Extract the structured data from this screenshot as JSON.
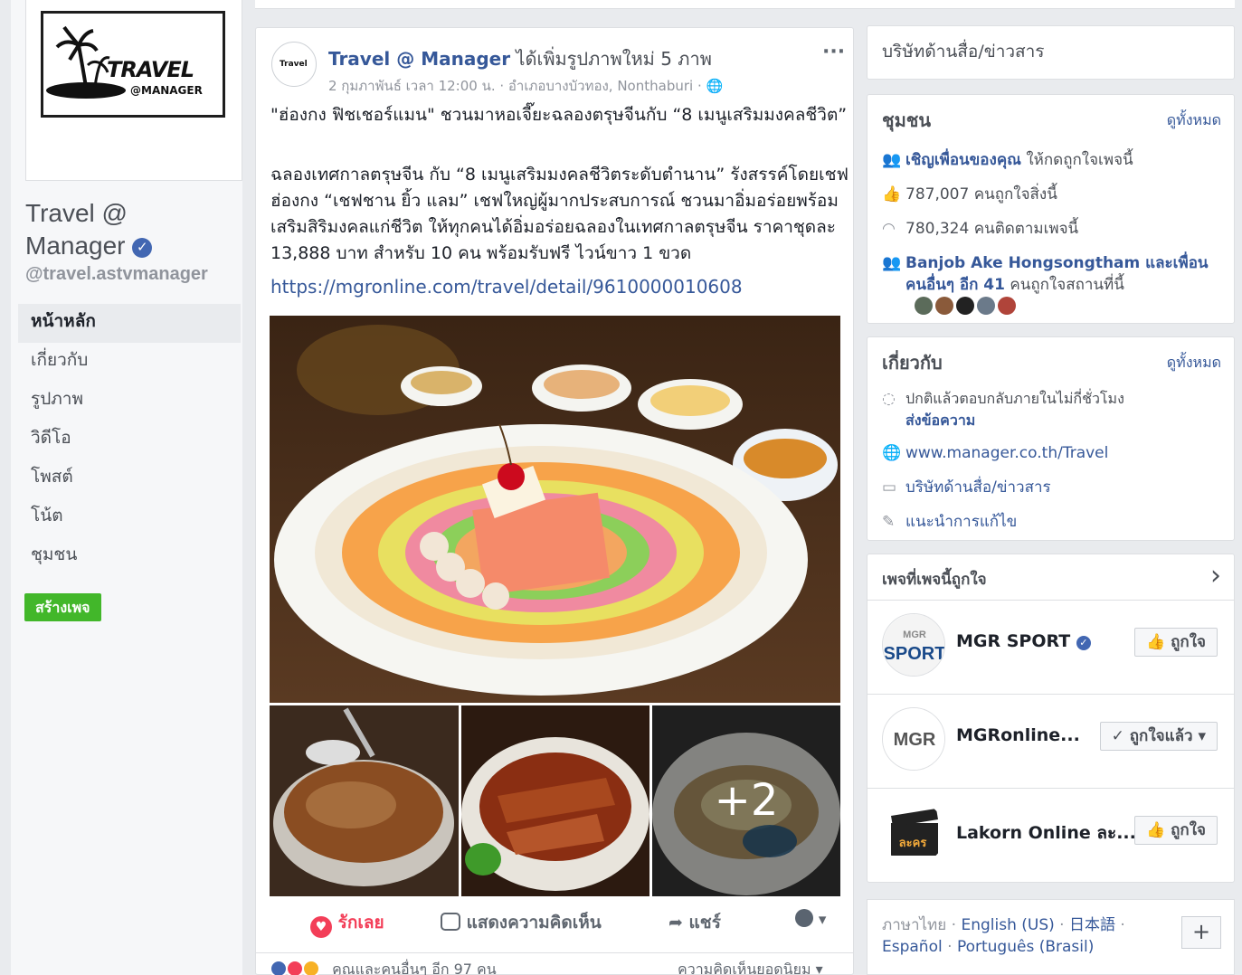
{
  "page": {
    "logo_line1": "TRAVEL",
    "logo_line2": "@MANAGER",
    "name_line1": "Travel @",
    "name_line2": "Manager",
    "verified_mark": "✓",
    "handle": "@travel.astvmanager",
    "create_page": "สร้างเพจ"
  },
  "nav": {
    "items": [
      "หน้าหลัก",
      "เกี่ยวกับ",
      "รูปภาพ",
      "วิดีโอ",
      "โพสต์",
      "โน้ต",
      "ชุมชน"
    ]
  },
  "post": {
    "avatar_text": "Travel",
    "author": "Travel @ Manager",
    "action": " ได้เพิ่มรูปภาพใหม่ 5 ภาพ",
    "meta": "2 กุมภาพันธ์ เวลา 12:00 น. · อำเภอบางบัวทอง, Nonthaburi · 🌐",
    "more": "···",
    "text_title": "\"ฮ่องกง ฟิชเชอร์แมน\" ชวนมาหอเจี๊ยะฉลองตรุษจีนกับ “8 เมนูเสริมมงคลชีวิต”",
    "text_body": "ฉลองเทศกาลตรุษจีน กับ “8 เมนูเสริมมงคลชีวิตระดับตำนาน” รังสรรค์โดยเชฟฮ่องกง “เชฟชาน ยิ้ว แลม” เชฟใหญ่ผู้มากประสบการณ์ ชวนมาอิ่มอร่อยพร้อมเสริมสิริมงคลแก่ชีวิต ให้ทุกคนได้อิ่มอร่อยฉลองในเทศกาลตรุษจีน ราคาชุดละ 13,888 บาท สำหรับ 10 คน พร้อมรับฟรี ไวน์ขาว 1 ขวด",
    "link": "https://mgronline.com/travel/detail/9610000010608",
    "more_photos": "+2",
    "love": "รักเลย",
    "comment": "แสดงความคิดเห็น",
    "share": "แชร์",
    "reactions_text": "คุณและคนอื่นๆ อีก 97 คน",
    "top_comments": "ความคิดเห็นยอดนิยม ▾"
  },
  "right": {
    "category": "บริษัทด้านสื่อ/ข่าวสาร",
    "community": {
      "title": "ชุมชน",
      "see_all": "ดูทั้งหมด",
      "invite_link": "เชิญเพื่อนของคุณ",
      "invite_rest": " ให้กดถูกใจเพจนี้",
      "likes": "787,007 คนถูกใจสิ่งนี้",
      "follows": "780,324 คนติดตามเพจนี้",
      "friends_name": "Banjob Ake Hongsongtham",
      "friends_rest": " และเพื่อน",
      "friends_line2_a": "คนอื่นๆ อีก 41",
      "friends_line2_b": " คนถูกใจสถานที่นี้"
    },
    "about": {
      "title": "เกี่ยวกับ",
      "see_all": "ดูทั้งหมด",
      "response": "ปกติแล้วตอบกลับภายในไม่กี่ชั่วโมง",
      "send_message": "ส่งข้อความ",
      "website": "www.manager.co.th/Travel",
      "category": "บริษัทด้านสื่อ/ข่าวสาร",
      "suggest_edit": "แนะนำการแก้ไข"
    },
    "liked_pages": {
      "title": "เพจที่เพจนี้ถูกใจ",
      "chevron": "›",
      "pages": [
        {
          "name": "MGR SPORT",
          "button": "ถูกใจ",
          "avatar_text": "SPORT"
        },
        {
          "name": "MGRonline...",
          "button": "ถูกใจแล้ว ▾",
          "avatar_text": "MGR"
        },
        {
          "name": "Lakorn Online ละ...",
          "button": "ถูกใจ",
          "avatar_text": "ละคร"
        }
      ]
    },
    "languages": {
      "line1_a": "ภาษาไทย",
      "line1_b": "English (US)",
      "line1_c": "日本語",
      "line2_a": "Español",
      "line2_b": "Português (Brasil)",
      "plus": "+"
    }
  },
  "colors": {
    "fb_blue": "#365899",
    "love_red": "#f33e58",
    "create_green": "#42b72a",
    "verified_blue": "#4267b2"
  }
}
